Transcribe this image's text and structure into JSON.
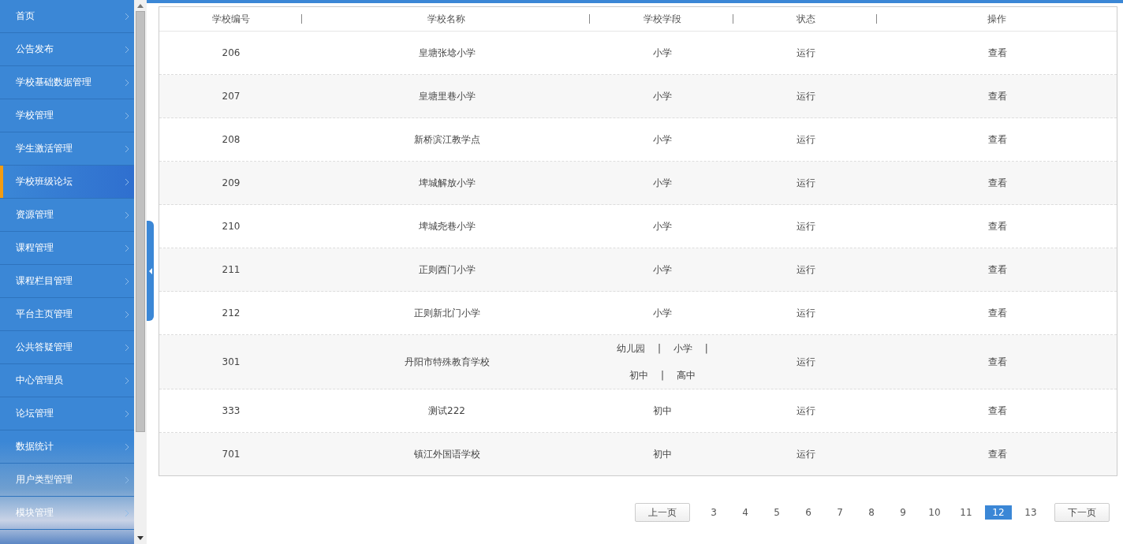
{
  "sidebar": {
    "items": [
      {
        "label": "首页",
        "selected": false
      },
      {
        "label": "公告发布",
        "selected": false
      },
      {
        "label": "学校基础数据管理",
        "selected": false
      },
      {
        "label": "学校管理",
        "selected": false
      },
      {
        "label": "学生激活管理",
        "selected": false
      },
      {
        "label": "学校班级论坛",
        "selected": true
      },
      {
        "label": "资源管理",
        "selected": false
      },
      {
        "label": "课程管理",
        "selected": false
      },
      {
        "label": "课程栏目管理",
        "selected": false
      },
      {
        "label": "平台主页管理",
        "selected": false
      },
      {
        "label": "公共答疑管理",
        "selected": false
      },
      {
        "label": "中心管理员",
        "selected": false
      },
      {
        "label": "论坛管理",
        "selected": false
      },
      {
        "label": "数据统计",
        "selected": false
      },
      {
        "label": "用户类型管理",
        "selected": false
      },
      {
        "label": "模块管理",
        "selected": false
      }
    ]
  },
  "table": {
    "columns": [
      "学校编号",
      "学校名称",
      "学校学段",
      "状态",
      "操作"
    ],
    "rows": [
      {
        "id": "206",
        "name": "皇塘张埝小学",
        "stage": "小学",
        "status": "运行",
        "action": "查看"
      },
      {
        "id": "207",
        "name": "皇塘里巷小学",
        "stage": "小学",
        "status": "运行",
        "action": "查看"
      },
      {
        "id": "208",
        "name": "新桥滨江教学点",
        "stage": "小学",
        "status": "运行",
        "action": "查看"
      },
      {
        "id": "209",
        "name": "埤城解放小学",
        "stage": "小学",
        "status": "运行",
        "action": "查看"
      },
      {
        "id": "210",
        "name": "埤城尧巷小学",
        "stage": "小学",
        "status": "运行",
        "action": "查看"
      },
      {
        "id": "211",
        "name": "正则西门小学",
        "stage": "小学",
        "status": "运行",
        "action": "查看"
      },
      {
        "id": "212",
        "name": "正则新北门小学",
        "stage": "小学",
        "status": "运行",
        "action": "查看"
      },
      {
        "id": "301",
        "name": "丹阳市特殊教育学校",
        "stage": "幼儿园　 |　 小学　 |　 初中　 |　 高中",
        "status": "运行",
        "action": "查看"
      },
      {
        "id": "333",
        "name": "测试222",
        "stage": "初中",
        "status": "运行",
        "action": "查看"
      },
      {
        "id": "701",
        "name": "镇江外国语学校",
        "stage": "初中",
        "status": "运行",
        "action": "查看"
      }
    ]
  },
  "pagination": {
    "prev": "上一页",
    "next": "下一页",
    "pages": [
      {
        "label": "3",
        "selected": false
      },
      {
        "label": "4",
        "selected": false
      },
      {
        "label": "5",
        "selected": false
      },
      {
        "label": "6",
        "selected": false
      },
      {
        "label": "7",
        "selected": false
      },
      {
        "label": "8",
        "selected": false
      },
      {
        "label": "9",
        "selected": false
      },
      {
        "label": "10",
        "selected": false
      },
      {
        "label": "11",
        "selected": false
      },
      {
        "label": "12",
        "selected": true
      },
      {
        "label": "13",
        "selected": false
      }
    ]
  }
}
